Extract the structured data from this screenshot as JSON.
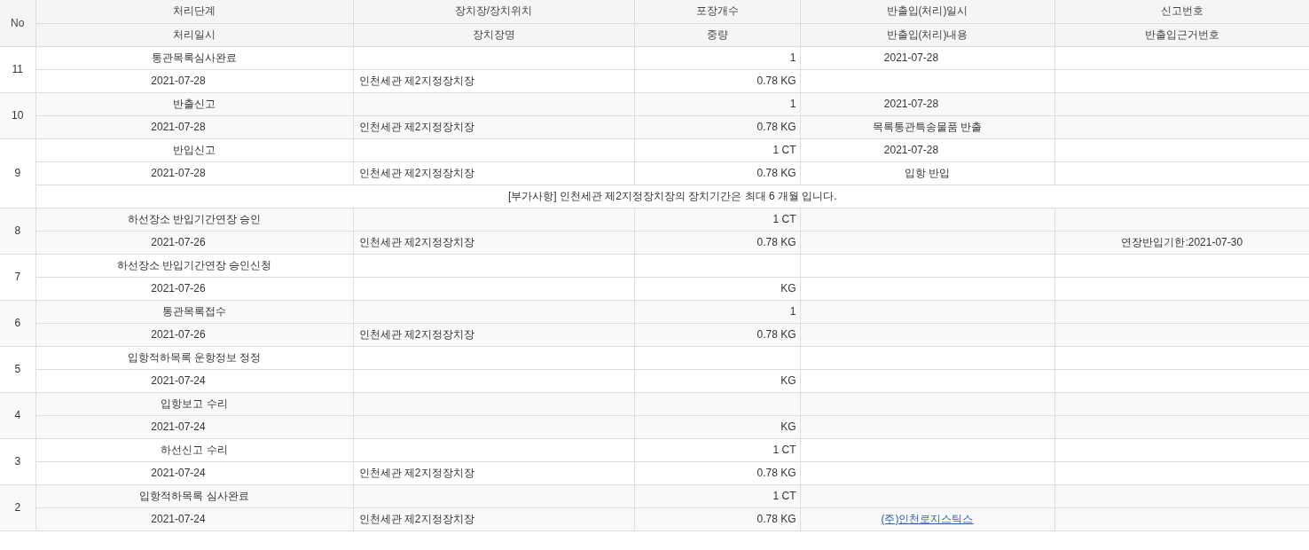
{
  "columns": {
    "number": "No",
    "top": [
      "처리단계",
      "장치장/장치위치",
      "포장개수",
      "반출입(처리)일시",
      "신고번호"
    ],
    "bottom": [
      "처리일시",
      "장치장명",
      "중량",
      "반출입(처리)내용",
      "반출입근거번호"
    ]
  },
  "rows": [
    {
      "no": "11",
      "stage": "통관목록심사완료",
      "packages": "1",
      "inout_time": "2021-07-28",
      "processed": "2021-07-28",
      "warehouse": "인천세관 제2지정장치장",
      "weight": "0.78 KG"
    },
    {
      "no": "10",
      "stage": "반출신고",
      "packages": "1",
      "inout_time": "2021-07-28",
      "processed": "2021-07-28",
      "warehouse": "인천세관 제2지정장치장",
      "weight": "0.78 KG",
      "inout_detail": "목록통관특송물품 반출",
      "detail_is_link": false
    },
    {
      "no": "9",
      "stage": "반입신고",
      "packages": "1 CT",
      "inout_time": "2021-07-28",
      "processed": "2021-07-28",
      "warehouse": "인천세관 제2지정장치장",
      "weight": "0.78 KG",
      "inout_detail": "입항 반입",
      "detail_is_link": false,
      "note": "[부가사항] 인천세관 제2지정장치장의 장치기간은 최대 6 개월 입니다."
    },
    {
      "no": "8",
      "stage": "하선장소 반입기간연장 승인",
      "packages": "1 CT",
      "processed": "2021-07-26",
      "warehouse": "인천세관 제2지정장치장",
      "weight": "0.78 KG",
      "basis_no": "연장반입기한:2021-07-30"
    },
    {
      "no": "7",
      "stage": "하선장소 반입기간연장 승인신청",
      "processed": "2021-07-26",
      "weight": "KG"
    },
    {
      "no": "6",
      "stage": "통관목록접수",
      "packages": "1",
      "processed": "2021-07-26",
      "warehouse": "인천세관 제2지정장치장",
      "weight": "0.78 KG"
    },
    {
      "no": "5",
      "stage": "입항적하목록 운항정보 정정",
      "processed": "2021-07-24",
      "weight": "KG"
    },
    {
      "no": "4",
      "stage": "입항보고 수리",
      "processed": "2021-07-24",
      "weight": "KG"
    },
    {
      "no": "3",
      "stage": "하선신고 수리",
      "packages": "1 CT",
      "processed": "2021-07-24",
      "warehouse": "인천세관 제2지정장치장",
      "weight": "0.78 KG"
    },
    {
      "no": "2",
      "stage": "입항적하목록 심사완료",
      "packages": "1 CT",
      "processed": "2021-07-24",
      "warehouse": "인천세관 제2지정장치장",
      "weight": "0.78 KG",
      "inout_detail": "(주)인천로지스틱스",
      "detail_is_link": true
    }
  ]
}
